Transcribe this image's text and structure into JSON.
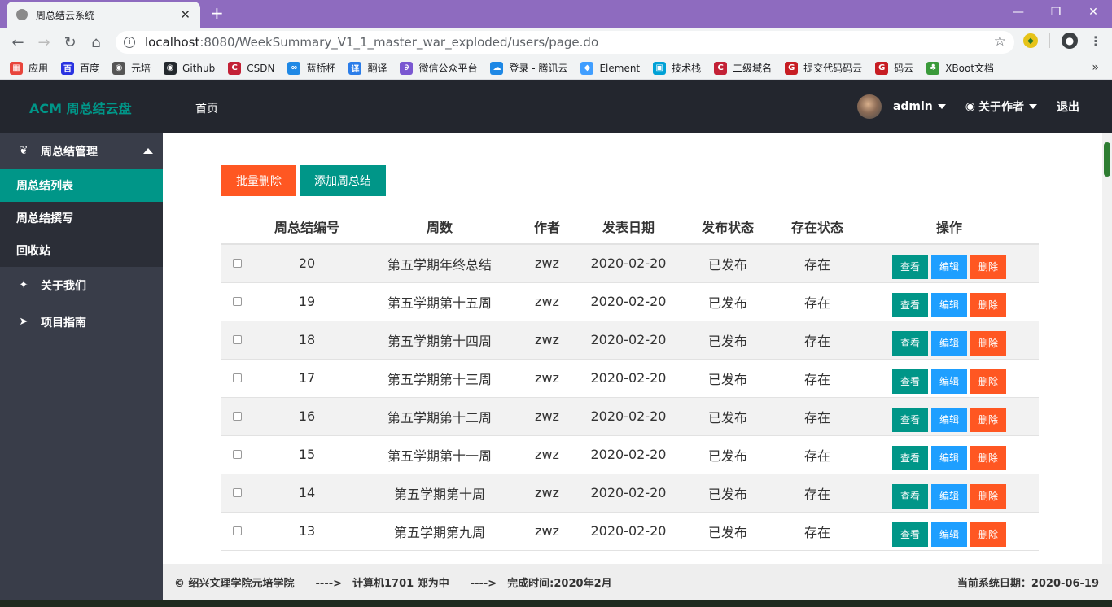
{
  "browser": {
    "tab_title": "周总结云系统",
    "url_host": "localhost",
    "url_path": ":8080/WeekSummary_V1_1_master_war_exploded/users/page.do",
    "bookmarks": [
      {
        "label": "应用",
        "icon": "apps-icon",
        "color": "#e8453c"
      },
      {
        "label": "百度",
        "icon": "baidu-icon",
        "color": "#2932e1"
      },
      {
        "label": "元培",
        "icon": "globe-icon",
        "color": "#555555"
      },
      {
        "label": "Github",
        "icon": "github-icon",
        "color": "#24292e"
      },
      {
        "label": "CSDN",
        "icon": "csdn-icon",
        "color": "#c32136"
      },
      {
        "label": "蓝桥杯",
        "icon": "lanqiao-icon",
        "color": "#1e88e5"
      },
      {
        "label": "翻译",
        "icon": "translate-icon",
        "color": "#2b7de9"
      },
      {
        "label": "微信公众平台",
        "icon": "wechat-icon",
        "color": "#7a57d1"
      },
      {
        "label": "登录 - 腾讯云",
        "icon": "cloud-icon",
        "color": "#1e88e5"
      },
      {
        "label": "Element",
        "icon": "element-icon",
        "color": "#409eff"
      },
      {
        "label": "技术栈",
        "icon": "bilibili-icon",
        "color": "#00a1d6"
      },
      {
        "label": "二级域名",
        "icon": "c-icon",
        "color": "#c32136"
      },
      {
        "label": "提交代码码云",
        "icon": "gitee-icon",
        "color": "#c71d23"
      },
      {
        "label": "码云",
        "icon": "gitee-icon",
        "color": "#c71d23"
      },
      {
        "label": "XBoot文档",
        "icon": "xboot-icon",
        "color": "#3a9a3a"
      }
    ]
  },
  "header": {
    "logo": "ACM 周总结云盘",
    "home": "首页",
    "user": "admin",
    "about_author": "关于作者",
    "logout": "退出"
  },
  "sidebar": {
    "group_title": "周总结管理",
    "items": [
      "周总结列表",
      "周总结撰写",
      "回收站"
    ],
    "about_us": "关于我们",
    "guide": "项目指南"
  },
  "toolbar": {
    "bulk_delete": "批量删除",
    "add": "添加周总结"
  },
  "table": {
    "headers": [
      "",
      "周总结编号",
      "周数",
      "作者",
      "发表日期",
      "发布状态",
      "存在状态",
      "操作"
    ],
    "actions": {
      "view": "查看",
      "edit": "编辑",
      "delete": "删除"
    },
    "rows": [
      {
        "id": "20",
        "week": "第五学期年终总结",
        "author": "zwz",
        "date": "2020-02-20",
        "publish": "已发布",
        "exist": "存在"
      },
      {
        "id": "19",
        "week": "第五学期第十五周",
        "author": "zwz",
        "date": "2020-02-20",
        "publish": "已发布",
        "exist": "存在"
      },
      {
        "id": "18",
        "week": "第五学期第十四周",
        "author": "zwz",
        "date": "2020-02-20",
        "publish": "已发布",
        "exist": "存在"
      },
      {
        "id": "17",
        "week": "第五学期第十三周",
        "author": "zwz",
        "date": "2020-02-20",
        "publish": "已发布",
        "exist": "存在"
      },
      {
        "id": "16",
        "week": "第五学期第十二周",
        "author": "zwz",
        "date": "2020-02-20",
        "publish": "已发布",
        "exist": "存在"
      },
      {
        "id": "15",
        "week": "第五学期第十一周",
        "author": "zwz",
        "date": "2020-02-20",
        "publish": "已发布",
        "exist": "存在"
      },
      {
        "id": "14",
        "week": "第五学期第十周",
        "author": "zwz",
        "date": "2020-02-20",
        "publish": "已发布",
        "exist": "存在"
      },
      {
        "id": "13",
        "week": "第五学期第九周",
        "author": "zwz",
        "date": "2020-02-20",
        "publish": "已发布",
        "exist": "存在"
      }
    ]
  },
  "footer": {
    "left": "© 绍兴文理学院元培学院　　---->　计算机1701 郑为中　　---->　完成时间:2020年2月",
    "right": "当前系统日期：2020-06-19"
  },
  "colors": {
    "accent": "#009688",
    "danger": "#ff5722",
    "info": "#1e9fff",
    "header_bg": "#23262e",
    "sidebar_bg": "#393d49"
  }
}
